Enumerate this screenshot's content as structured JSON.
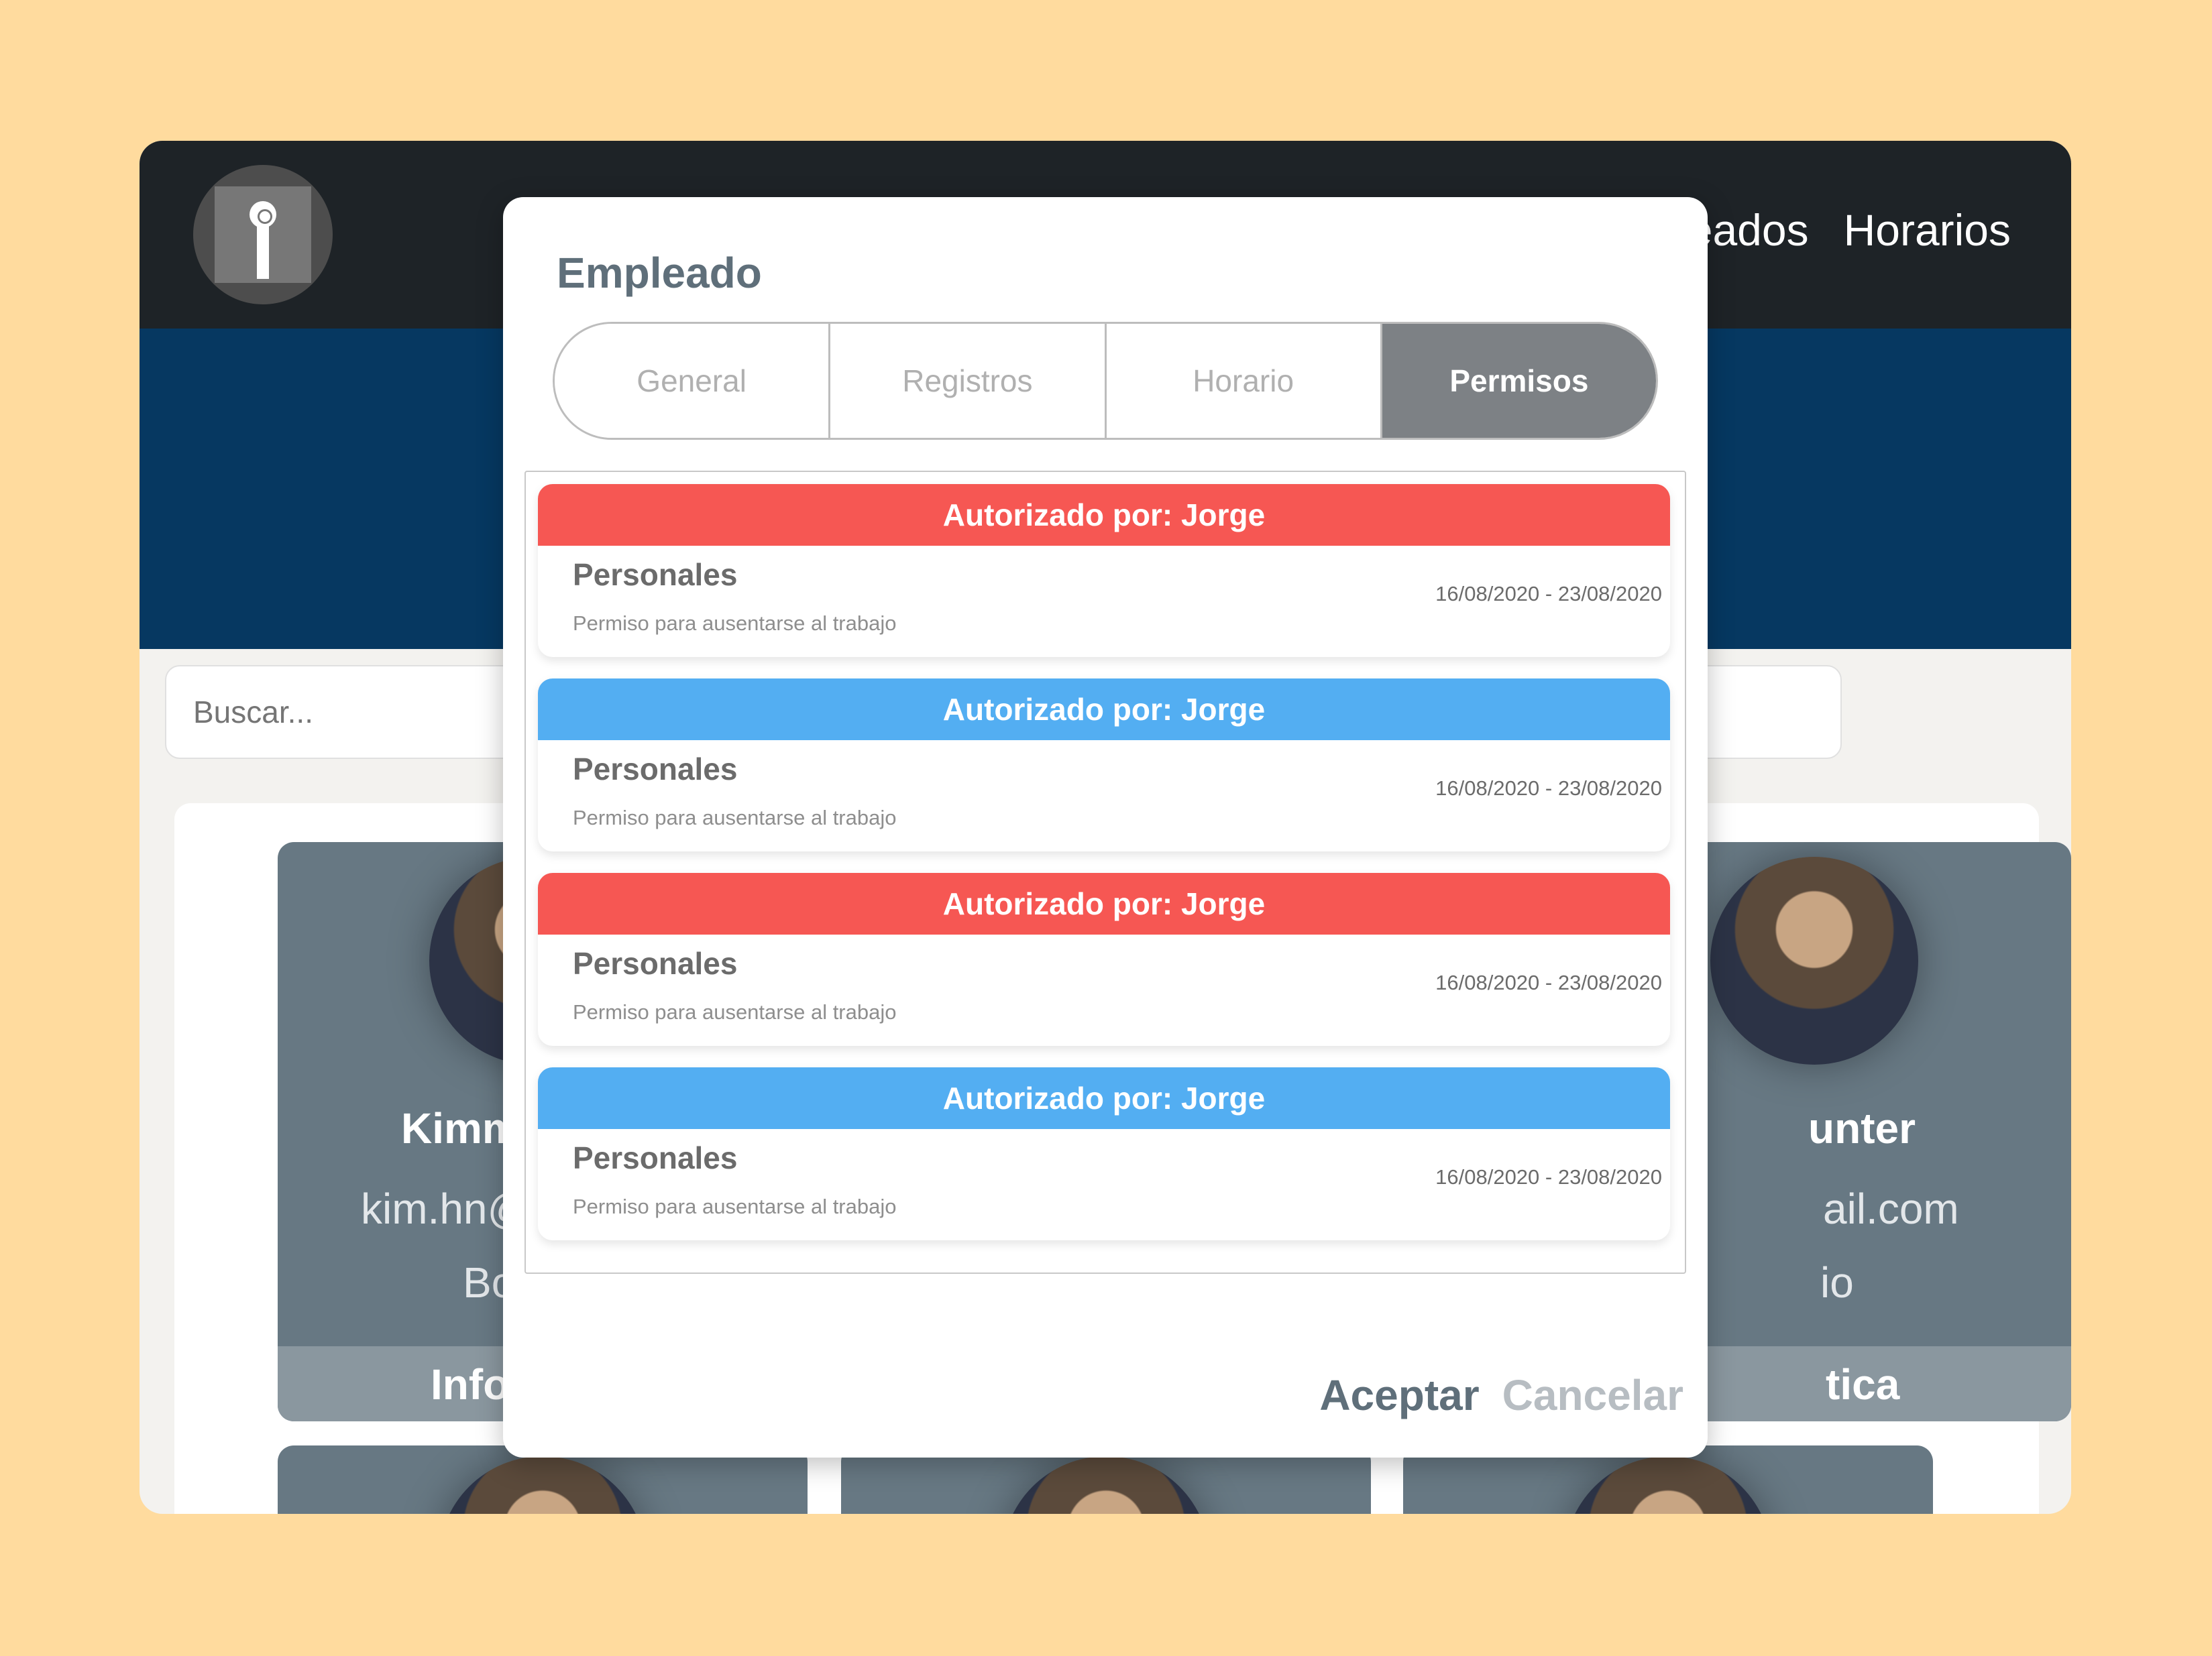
{
  "nav": {
    "items": [
      "Empleados",
      "Horarios"
    ]
  },
  "search": {
    "placeholder": "Buscar..."
  },
  "cards": [
    {
      "name": "Kimm",
      "email": "kim.hn@",
      "dept": "Bo",
      "footer": "Info"
    },
    {
      "name": "unter",
      "email": "ail.com",
      "dept": "io",
      "footer": "tica"
    }
  ],
  "modal": {
    "title": "Empleado",
    "tabs": [
      "General",
      "Registros",
      "Horario",
      "Permisos"
    ],
    "active_tab": "Permisos",
    "permissions": [
      {
        "header": "Autorizado por: Jorge",
        "type": "Personales",
        "description": "Permiso para ausentarse al trabajo",
        "dates": "16/08/2020 - 23/08/2020",
        "color": "#F65753"
      },
      {
        "header": "Autorizado por: Jorge",
        "type": "Personales",
        "description": "Permiso para ausentarse al trabajo",
        "dates": "16/08/2020 - 23/08/2020",
        "color": "#53AEF2"
      },
      {
        "header": "Autorizado por: Jorge",
        "type": "Personales",
        "description": "Permiso para ausentarse al trabajo",
        "dates": "16/08/2020 - 23/08/2020",
        "color": "#F65753"
      },
      {
        "header": "Autorizado por: Jorge",
        "type": "Personales",
        "description": "Permiso para ausentarse al trabajo",
        "dates": "16/08/2020 - 23/08/2020",
        "color": "#53AEF2"
      }
    ],
    "accept_label": "Aceptar",
    "cancel_label": "Cancelar"
  },
  "colors": {
    "page_bg": "#FFDB9E",
    "topbar": "#1E2327",
    "hero": "#063861",
    "card": "#677883"
  }
}
